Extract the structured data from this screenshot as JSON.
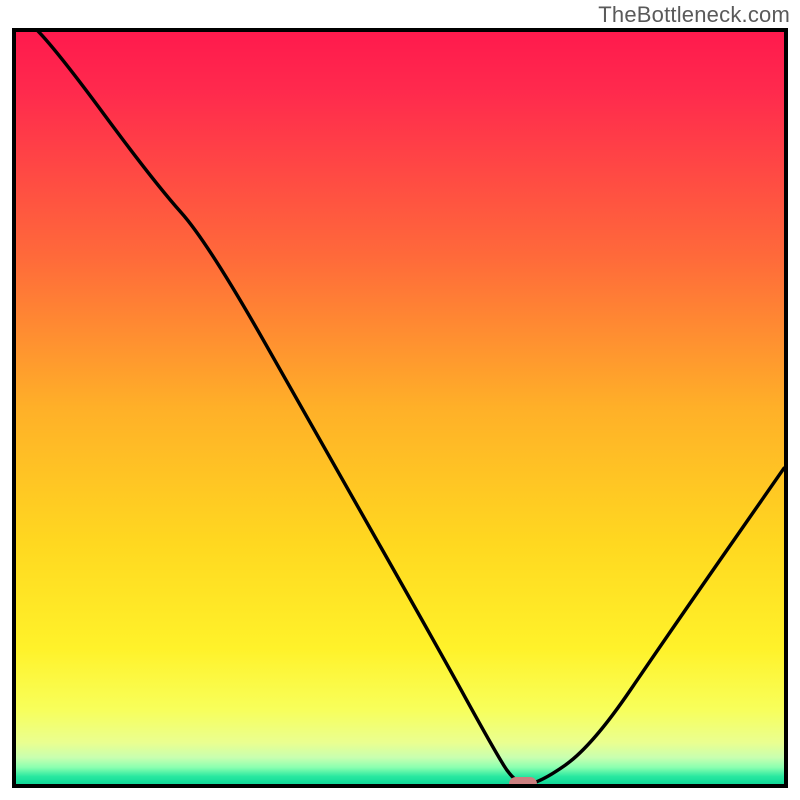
{
  "watermark": "TheBottleneck.com",
  "chart_data": {
    "type": "line",
    "title": "",
    "xlabel": "",
    "ylabel": "",
    "xlim": [
      0,
      100
    ],
    "ylim": [
      0,
      100
    ],
    "series": [
      {
        "name": "bottleneck-curve",
        "x": [
          0,
          5,
          18,
          25,
          40,
          55,
          62,
          65,
          68,
          75,
          85,
          100
        ],
        "y": [
          103,
          98,
          80,
          72,
          45,
          18,
          5,
          0,
          0,
          5,
          20,
          42
        ]
      }
    ],
    "marker": {
      "x": 66,
      "y": 0
    },
    "gradient_stops": [
      {
        "offset": 0.0,
        "color": "#ff1a4d"
      },
      {
        "offset": 0.08,
        "color": "#ff2a4d"
      },
      {
        "offset": 0.3,
        "color": "#ff6a3a"
      },
      {
        "offset": 0.5,
        "color": "#ffb028"
      },
      {
        "offset": 0.68,
        "color": "#ffd820"
      },
      {
        "offset": 0.82,
        "color": "#fff22a"
      },
      {
        "offset": 0.9,
        "color": "#f8ff5a"
      },
      {
        "offset": 0.945,
        "color": "#eaff90"
      },
      {
        "offset": 0.965,
        "color": "#c8ffb0"
      },
      {
        "offset": 0.978,
        "color": "#8affb0"
      },
      {
        "offset": 0.99,
        "color": "#28e8a0"
      },
      {
        "offset": 1.0,
        "color": "#10d898"
      }
    ]
  }
}
